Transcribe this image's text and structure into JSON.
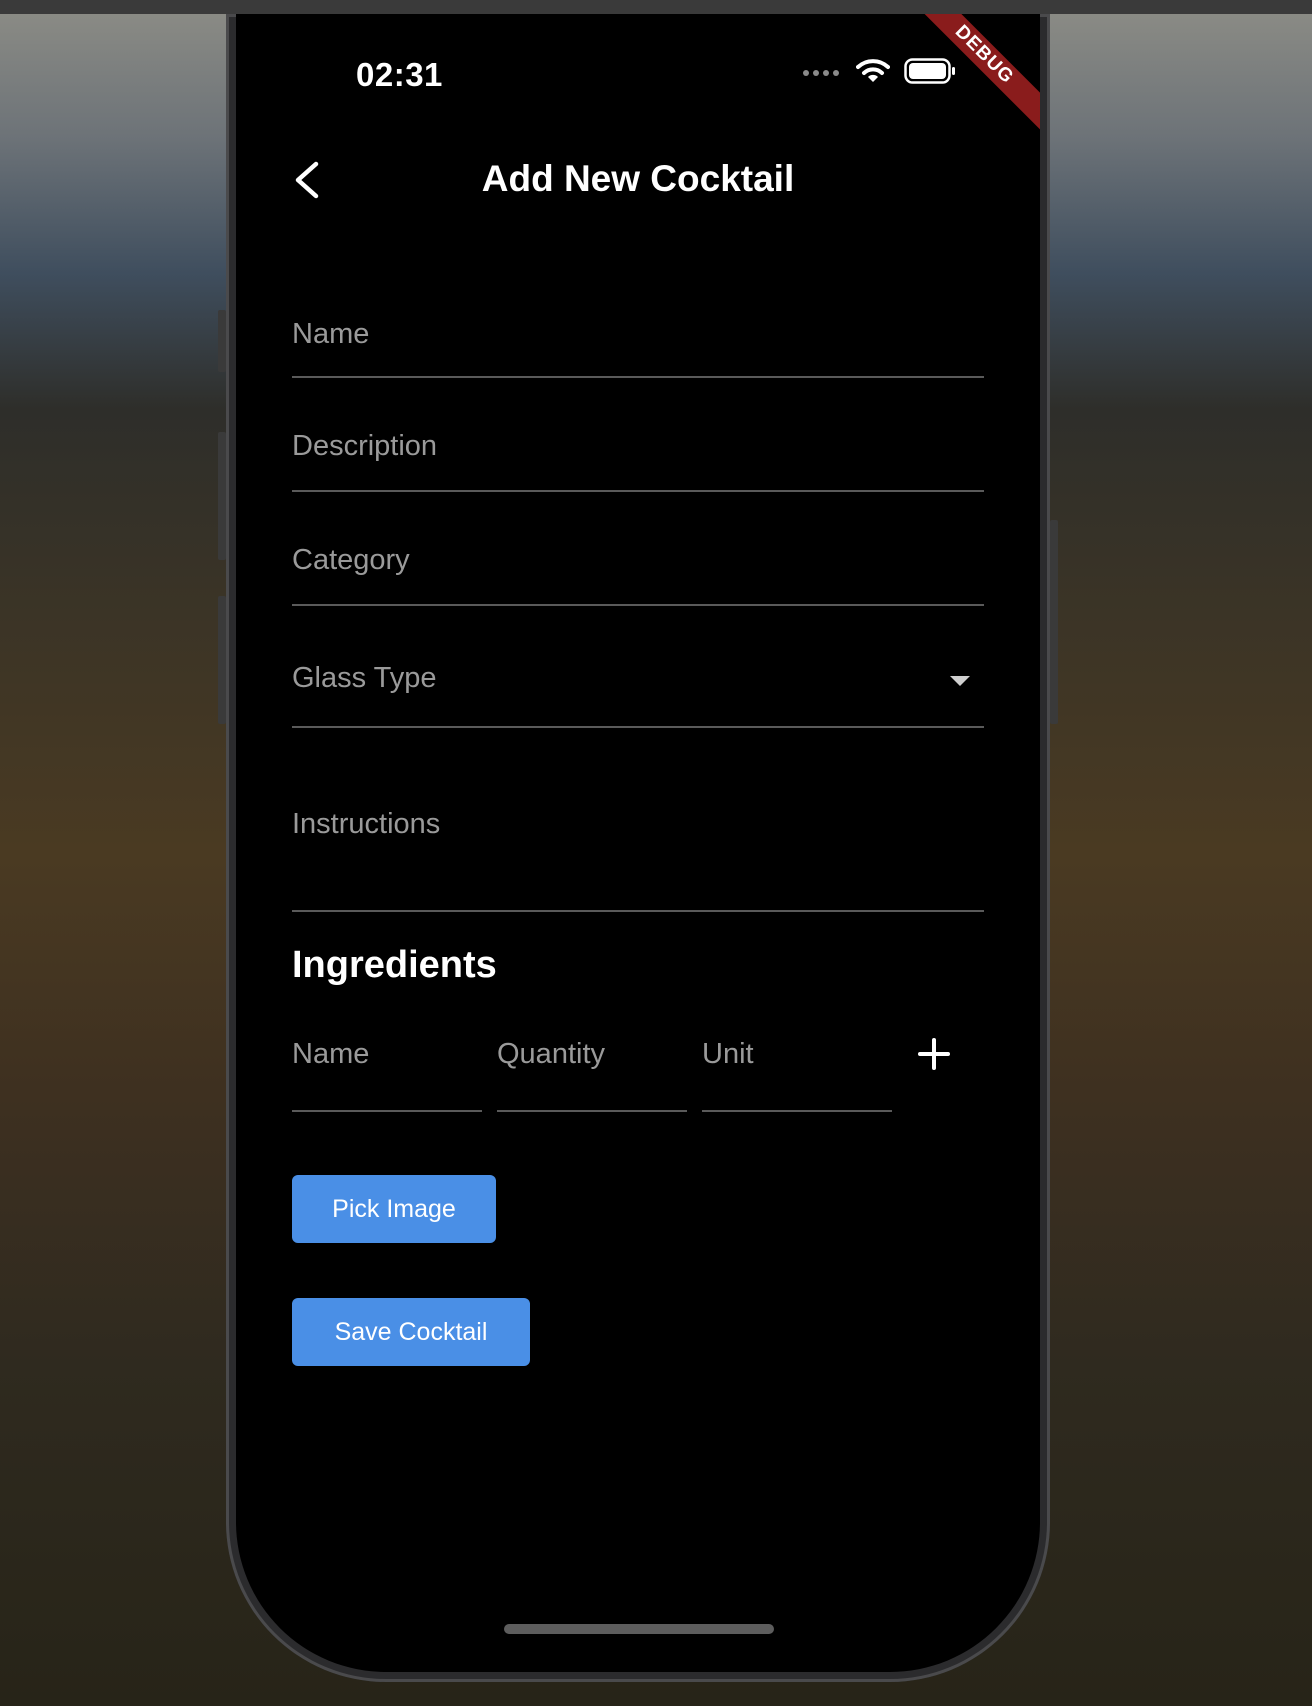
{
  "status_bar": {
    "time": "02:31"
  },
  "debug_banner": "DEBUG",
  "appbar": {
    "title": "Add New Cocktail"
  },
  "form": {
    "name_label": "Name",
    "description_label": "Description",
    "category_label": "Category",
    "glass_type_label": "Glass Type",
    "instructions_label": "Instructions"
  },
  "ingredients": {
    "title": "Ingredients",
    "name_label": "Name",
    "quantity_label": "Quantity",
    "unit_label": "Unit"
  },
  "buttons": {
    "pick_image": "Pick Image",
    "save_cocktail": "Save Cocktail"
  },
  "colors": {
    "accent": "#4a8fe6",
    "background": "#000000",
    "debug_banner": "#8a1c1c"
  },
  "icons": [
    "back-chevron-icon",
    "signal-dots-icon",
    "wifi-icon",
    "battery-icon",
    "dropdown-caret-icon",
    "plus-icon"
  ]
}
